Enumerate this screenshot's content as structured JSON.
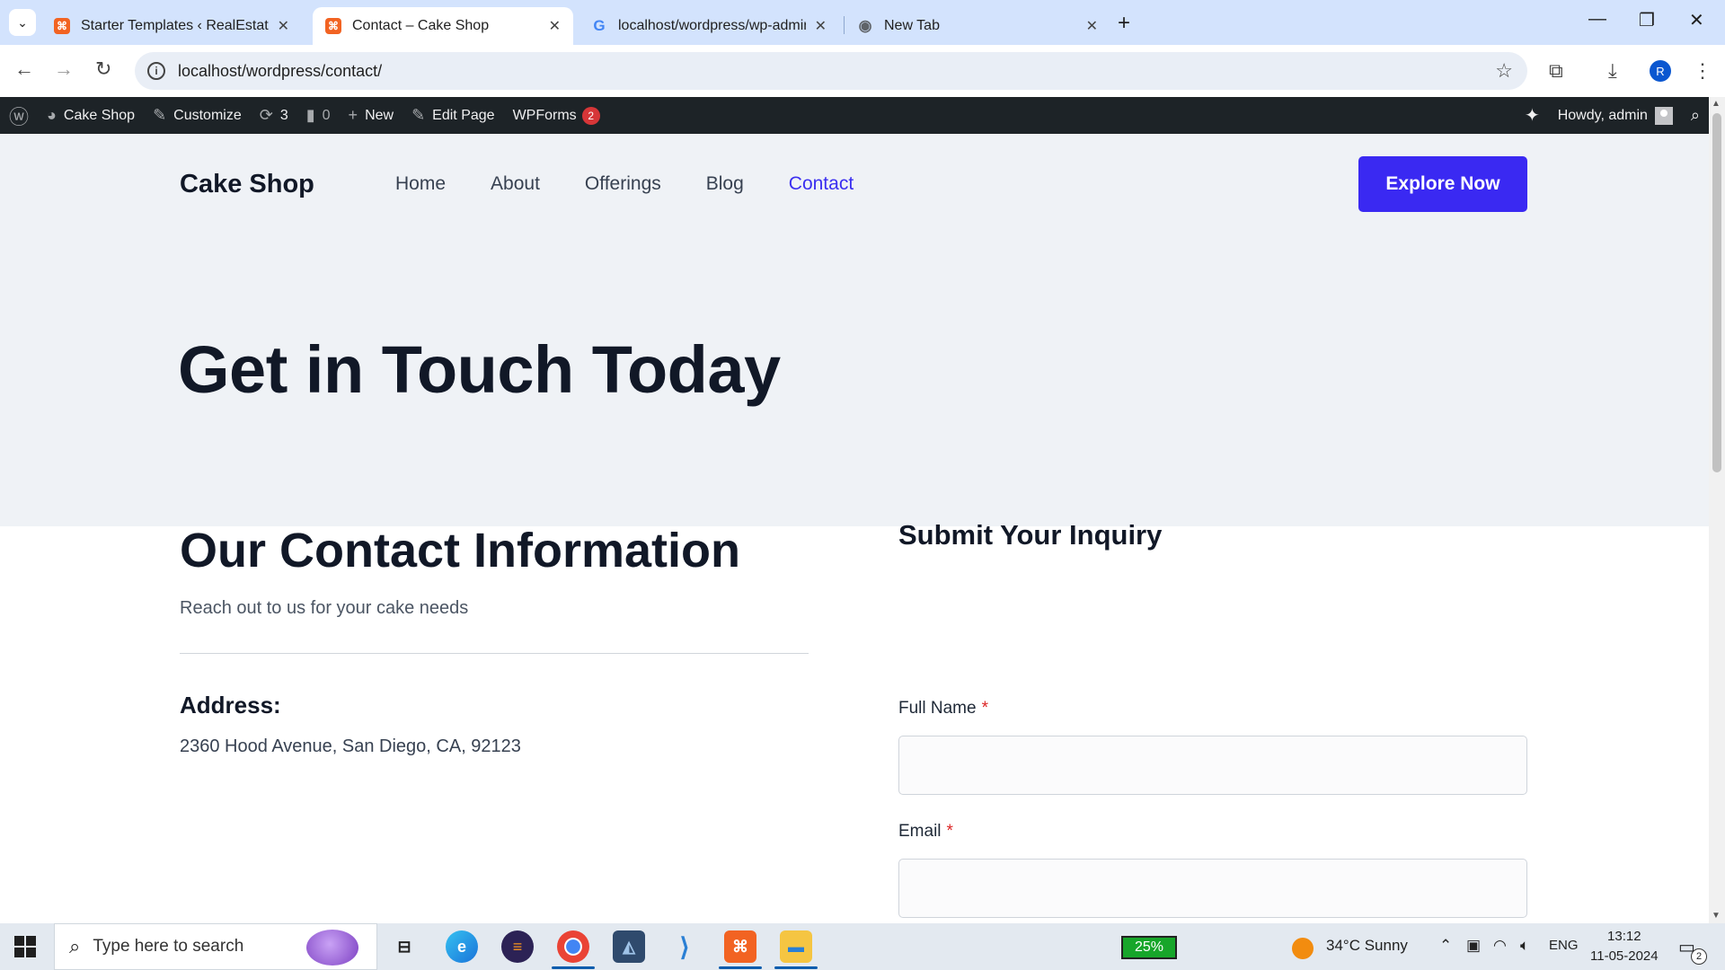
{
  "browser": {
    "tabs": [
      {
        "title": "Starter Templates ‹ RealEstate-E",
        "icon": "xampp-icon",
        "active": false
      },
      {
        "title": "Contact – Cake Shop",
        "icon": "xampp-icon",
        "active": true
      },
      {
        "title": "localhost/wordpress/wp-admin",
        "icon": "google-icon",
        "active": false
      },
      {
        "title": "New Tab",
        "icon": "chrome-icon",
        "active": false
      }
    ],
    "url": "localhost/wordpress/contact/",
    "profile_initial": "R"
  },
  "adminbar": {
    "site_name": "Cake Shop",
    "customize": "Customize",
    "updates_count": "3",
    "comments_count": "0",
    "new_label": "New",
    "edit_page": "Edit Page",
    "wpforms": "WPForms",
    "wpforms_badge": "2",
    "howdy": "Howdy, admin"
  },
  "site": {
    "logo": "Cake Shop",
    "nav": [
      "Home",
      "About",
      "Offerings",
      "Blog",
      "Contact"
    ],
    "current_nav": "Contact",
    "cta": "Explore Now",
    "hero_title": "Get in Touch Today",
    "contact_title": "Our Contact Information",
    "contact_sub": "Reach out to us for your cake needs",
    "address_label": "Address:",
    "address_value": "2360 Hood Avenue, San Diego, CA, 92123",
    "form_title": "Submit Your Inquiry",
    "form_fields": [
      {
        "label": "Full Name",
        "required_mark": "*",
        "value": ""
      },
      {
        "label": "Email",
        "required_mark": "*",
        "value": ""
      }
    ],
    "accent_color": "#3a29f2"
  },
  "taskbar": {
    "search_placeholder": "Type here to search",
    "battery": "25%",
    "weather": "34°C  Sunny",
    "lang": "ENG",
    "time": "13:12",
    "date": "11-05-2024",
    "notifications": "2"
  }
}
